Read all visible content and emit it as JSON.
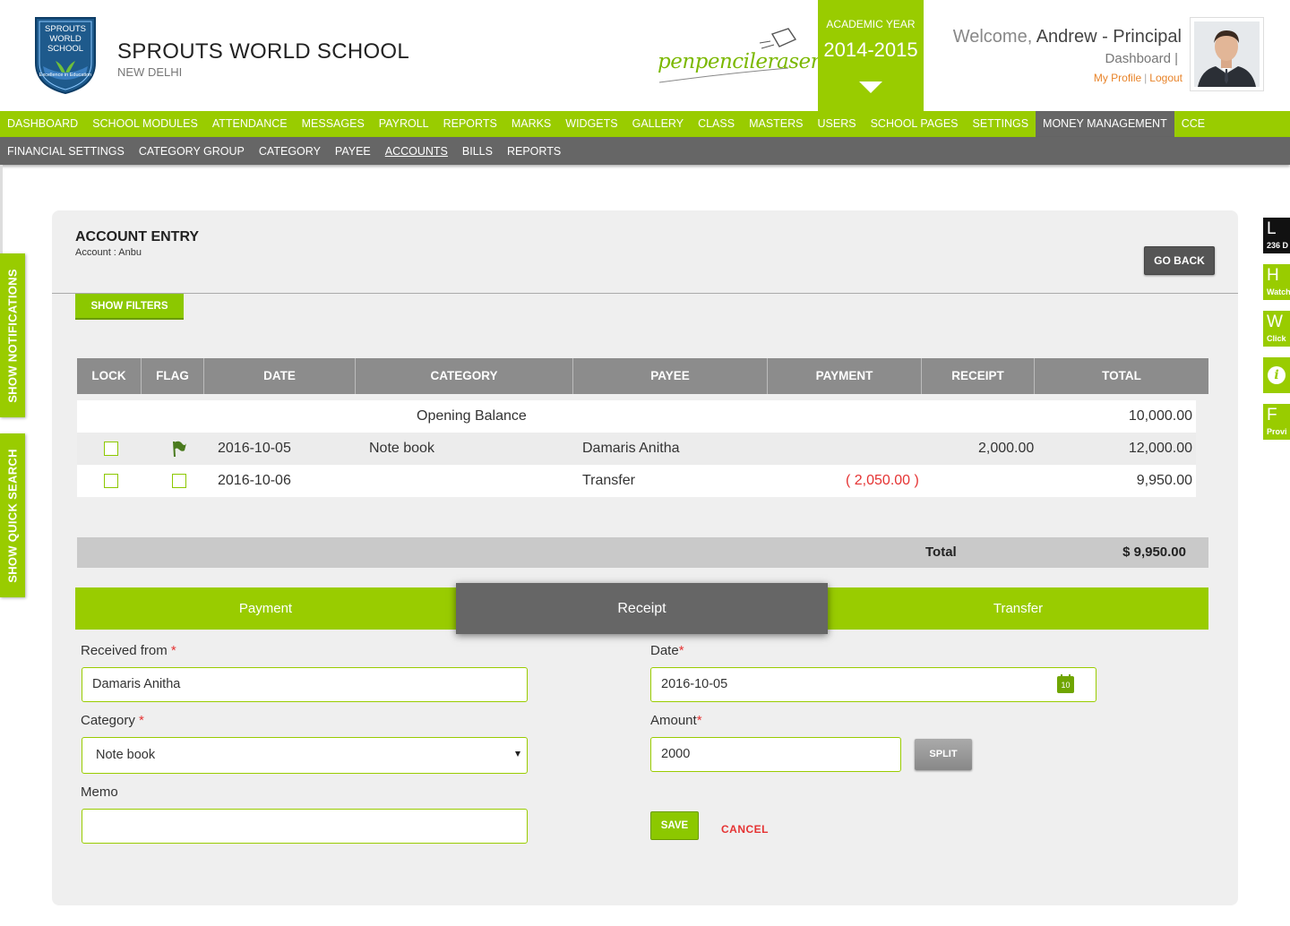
{
  "school": {
    "logo_text": [
      "SPROUTS",
      "WORLD",
      "SCHOOL"
    ],
    "logo_ribbon": "Excellence in Education",
    "name": "SPROUTS WORLD SCHOOL",
    "city": "NEW DELHI"
  },
  "brand_logo": "penpencileraser",
  "academic_year": {
    "label": "ACADEMIC YEAR",
    "value": "2014-2015"
  },
  "user": {
    "welcome": "Welcome,",
    "name": "Andrew - Principal",
    "dashboard": "Dashboard |",
    "my_profile": "My Profile",
    "logout": "Logout"
  },
  "nav": [
    "DASHBOARD",
    "SCHOOL MODULES",
    "ATTENDANCE",
    "MESSAGES",
    "PAYROLL",
    "REPORTS",
    "MARKS",
    "WIDGETS",
    "GALLERY",
    "CLASS",
    "MASTERS",
    "USERS",
    "SCHOOL PAGES",
    "SETTINGS",
    "MONEY MANAGEMENT",
    "CCE"
  ],
  "nav_active": "MONEY MANAGEMENT",
  "subnav": [
    "FINANCIAL SETTINGS",
    "CATEGORY GROUP",
    "CATEGORY",
    "PAYEE",
    "ACCOUNTS",
    "BILLS",
    "REPORTS"
  ],
  "subnav_active": "ACCOUNTS",
  "side_tabs": {
    "notifications": "SHOW NOTIFICATIONS",
    "quick_search": "SHOW QUICK SEARCH"
  },
  "right_widgets": [
    {
      "letter": "L",
      "text": "236 D"
    },
    {
      "letter": "H",
      "text": "Watch"
    },
    {
      "letter": "W",
      "text": "Click"
    },
    {
      "letter": "i",
      "text": ""
    },
    {
      "letter": "F",
      "text": "Provi"
    }
  ],
  "panel": {
    "title": "ACCOUNT ENTRY",
    "subtitle": "Account : Anbu",
    "go_back": "GO BACK",
    "show_filters": "SHOW FILTERS"
  },
  "table": {
    "headers": [
      "LOCK",
      "FLAG",
      "DATE",
      "CATEGORY",
      "PAYEE",
      "PAYMENT",
      "RECEIPT",
      "TOTAL"
    ],
    "opening_balance": {
      "label": "Opening Balance",
      "total": "10,000.00"
    },
    "rows": [
      {
        "date": "2016-10-05",
        "category": "Note book",
        "payee": "Damaris Anitha",
        "payment": "",
        "receipt": "2,000.00",
        "total": "12,000.00",
        "flagged": true
      },
      {
        "date": "2016-10-06",
        "category": "",
        "payee": "Transfer",
        "payment": "( 2,050.00 )",
        "receipt": "",
        "total": "9,950.00",
        "flagged": false
      }
    ],
    "total_label": "Total",
    "total_value": "$ 9,950.00"
  },
  "entry_tabs": [
    "Payment",
    "Receipt",
    "Transfer"
  ],
  "entry_tab_active": "Receipt",
  "form": {
    "received_from": {
      "label": "Received from",
      "value": "Damaris Anitha"
    },
    "date": {
      "label": "Date",
      "value": "2016-10-05",
      "cal_day": "10"
    },
    "category": {
      "label": "Category",
      "value": "Note book"
    },
    "amount": {
      "label": "Amount",
      "value": "2000"
    },
    "memo": {
      "label": "Memo",
      "value": ""
    },
    "required_mark": "*",
    "split": "SPLIT",
    "save": "SAVE",
    "cancel": "CANCEL"
  },
  "colors": {
    "brand_green": "#99cc00",
    "nav_gray": "#666666",
    "negative": "#e53333",
    "link_orange": "#e8842a"
  }
}
